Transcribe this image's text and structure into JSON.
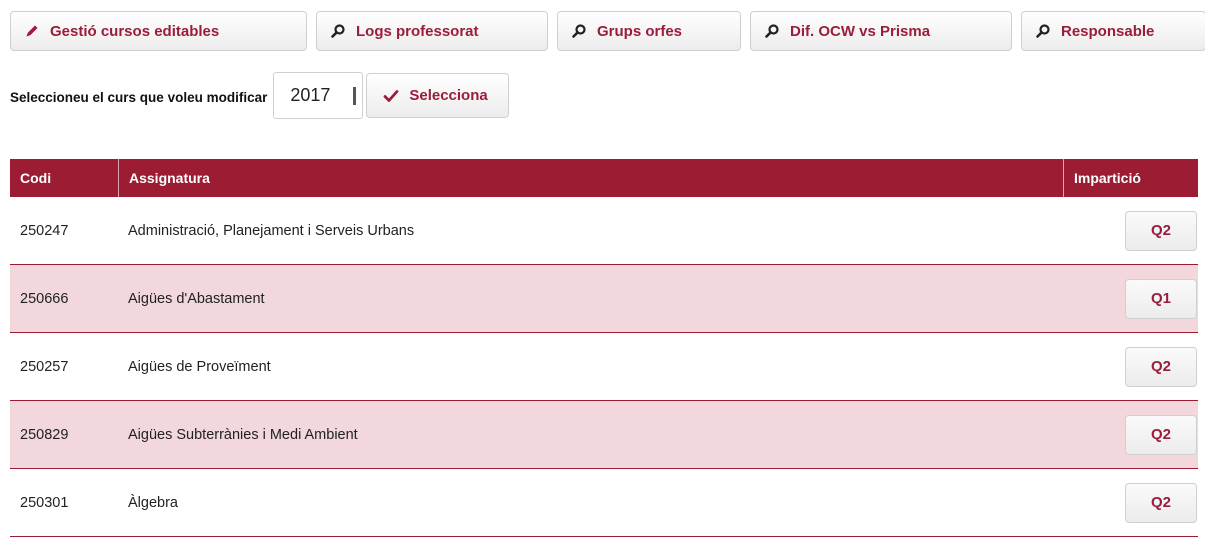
{
  "toolbar": {
    "buttons": [
      {
        "label": "Gestió cursos editables",
        "icon": "pencil-icon"
      },
      {
        "label": "Logs professorat",
        "icon": "search-icon"
      },
      {
        "label": "Grups orfes",
        "icon": "search-icon"
      },
      {
        "label": "Dif. OCW vs Prisma",
        "icon": "search-icon"
      },
      {
        "label": "Responsable",
        "icon": "search-icon"
      }
    ]
  },
  "course_select": {
    "label": "Seleccioneu el curs que voleu modificar",
    "year": "2017",
    "button_label": "Selecciona",
    "button_icon": "check-icon"
  },
  "table": {
    "headers": [
      "Codi",
      "Assignatura",
      "Impartició"
    ],
    "rows": [
      {
        "code": "250247",
        "subject": "Administració, Planejament i Serveis Urbans",
        "period": "Q2"
      },
      {
        "code": "250666",
        "subject": "Aigües d'Abastament",
        "period": "Q1"
      },
      {
        "code": "250257",
        "subject": "Aigües de Proveïment",
        "period": "Q2"
      },
      {
        "code": "250829",
        "subject": "Aigües Subterrànies i Medi Ambient",
        "period": "Q2"
      },
      {
        "code": "250301",
        "subject": "Àlgebra",
        "period": "Q2"
      }
    ]
  },
  "colors": {
    "accent": "#9b1d3b",
    "header_bg": "#9b1c33",
    "alt_row": "#f2d8dc"
  }
}
